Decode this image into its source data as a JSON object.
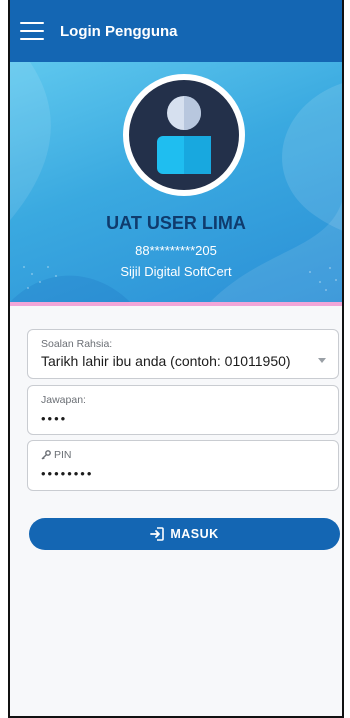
{
  "app": {
    "title": "Login Pengguna"
  },
  "profile": {
    "name": "UAT USER LIMA",
    "masked_id": "88*********205",
    "cert_type": "Sijil Digital SoftCert"
  },
  "form": {
    "secret_question": {
      "label": "Soalan Rahsia:",
      "value": "Tarikh lahir ibu anda (contoh: 01011950)"
    },
    "answer": {
      "label": "Jawapan:",
      "value": "••••"
    },
    "pin": {
      "label": "PIN",
      "value": "••••••••"
    },
    "submit_label": "MASUK"
  },
  "colors": {
    "primary": "#1466b3",
    "hero_light": "#5fc8ee",
    "hero_dark": "#2b8fd6",
    "name_text": "#0f3b6d",
    "accent_pink": "#f2a6d8"
  },
  "icons": {
    "menu": "hamburger-icon",
    "avatar": "user-avatar-icon",
    "key": "key-icon",
    "login": "login-arrow-icon",
    "dropdown": "chevron-down-icon"
  }
}
